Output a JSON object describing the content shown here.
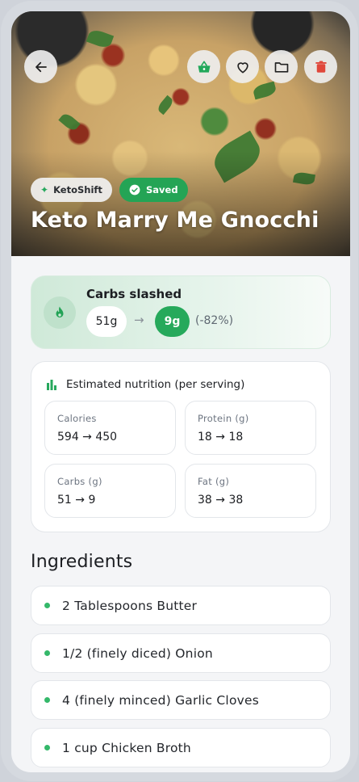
{
  "hero": {
    "title": "Keto Marry Me Gnocchi",
    "source_chip": "KetoShift",
    "saved_chip": "Saved",
    "icons": [
      "arrow-left-icon",
      "basket-icon",
      "heart-icon",
      "folder-icon",
      "trash-icon"
    ]
  },
  "carbs": {
    "heading": "Carbs slashed",
    "before": "51g",
    "after": "9g",
    "change": "(-82%)"
  },
  "nutrition": {
    "heading": "Estimated nutrition (per serving)",
    "cells": [
      {
        "label": "Calories",
        "value": "594 → 450"
      },
      {
        "label": "Protein (g)",
        "value": "18 → 18"
      },
      {
        "label": "Carbs (g)",
        "value": "51 → 9"
      },
      {
        "label": "Fat (g)",
        "value": "38 → 38"
      }
    ]
  },
  "ingredients": {
    "heading": "Ingredients",
    "items": [
      "2 Tablespoons Butter",
      "1/2 (finely diced) Onion",
      "4 (finely minced) Garlic Cloves",
      "1 cup Chicken Broth"
    ]
  },
  "colors": {
    "accent": "#2bb665",
    "delete": "#e0473a",
    "text": "#1c1e22"
  }
}
